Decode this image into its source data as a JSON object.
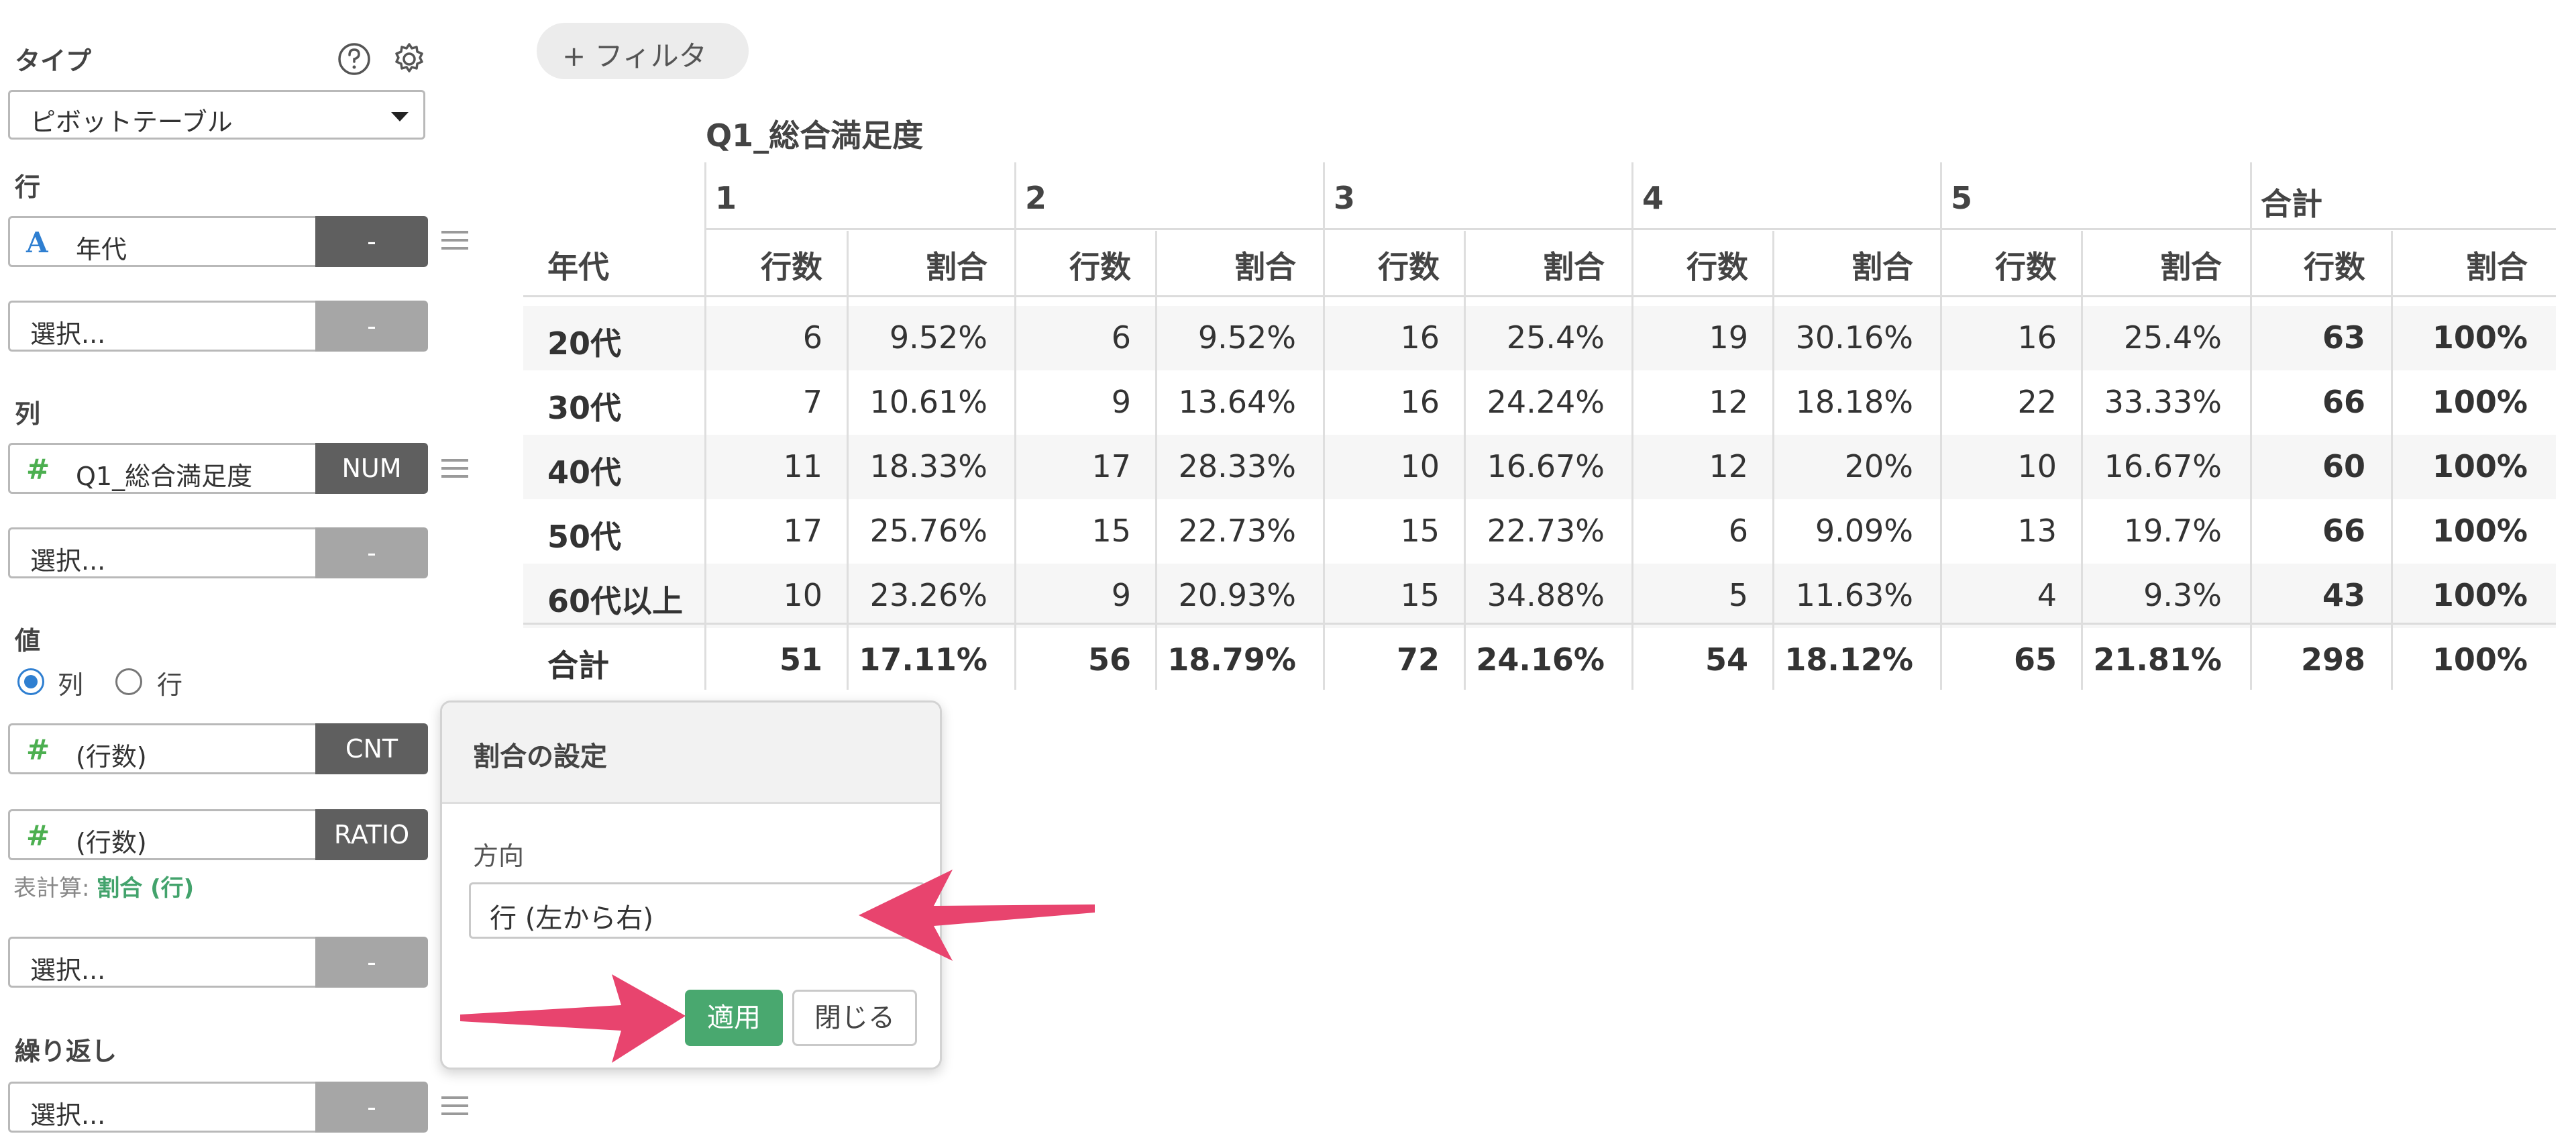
{
  "sidebar": {
    "type_label": "タイプ",
    "type_value": "ピボットテーブル",
    "row_label": "行",
    "col_label": "列",
    "value_label": "値",
    "repeat_label": "繰り返し",
    "placeholder": "選択...",
    "dash": "-",
    "row_field": {
      "name": "年代",
      "icon": "A"
    },
    "col_field": {
      "name": "Q1_総合満足度",
      "icon": "#",
      "tag": "NUM"
    },
    "value_fields": [
      {
        "name": "(行数)",
        "icon": "#",
        "tag": "CNT"
      },
      {
        "name": "(行数)",
        "icon": "#",
        "tag": "RATIO"
      }
    ],
    "value_direction": {
      "options": [
        "列",
        "行"
      ],
      "selected": "列"
    },
    "calc_prefix": "表計算:",
    "calc_value": "割合 (行)"
  },
  "toolbar": {
    "filter_label": "+ フィルタ"
  },
  "pivot": {
    "col_title": "Q1_総合満足度",
    "groups": [
      "1",
      "2",
      "3",
      "4",
      "5",
      "合計"
    ],
    "row_header": "年代",
    "sub_headers": [
      "行数",
      "割合"
    ],
    "rows": [
      {
        "label": "20代",
        "cells": [
          "6",
          "9.52%",
          "6",
          "9.52%",
          "16",
          "25.4%",
          "19",
          "30.16%",
          "16",
          "25.4%",
          "63",
          "100%"
        ]
      },
      {
        "label": "30代",
        "cells": [
          "7",
          "10.61%",
          "9",
          "13.64%",
          "16",
          "24.24%",
          "12",
          "18.18%",
          "22",
          "33.33%",
          "66",
          "100%"
        ]
      },
      {
        "label": "40代",
        "cells": [
          "11",
          "18.33%",
          "17",
          "28.33%",
          "10",
          "16.67%",
          "12",
          "20%",
          "10",
          "16.67%",
          "60",
          "100%"
        ]
      },
      {
        "label": "50代",
        "cells": [
          "17",
          "25.76%",
          "15",
          "22.73%",
          "15",
          "22.73%",
          "6",
          "9.09%",
          "13",
          "19.7%",
          "66",
          "100%"
        ]
      },
      {
        "label": "60代以上",
        "cells": [
          "10",
          "23.26%",
          "9",
          "20.93%",
          "15",
          "34.88%",
          "5",
          "11.63%",
          "4",
          "9.3%",
          "43",
          "100%"
        ]
      }
    ],
    "total": {
      "label": "合計",
      "cells": [
        "51",
        "17.11%",
        "56",
        "18.79%",
        "72",
        "24.16%",
        "54",
        "18.12%",
        "65",
        "21.81%",
        "298",
        "100%"
      ]
    }
  },
  "popover": {
    "title": "割合の設定",
    "direction_label": "方向",
    "direction_value": "行 (左から右)",
    "apply_label": "適用",
    "close_label": "閉じる"
  },
  "colors": {
    "accent_green": "#49a86f",
    "arrow_pink": "#e8446e",
    "tag_dark": "#5f5f5f",
    "radio_blue": "#2f7fd1"
  }
}
